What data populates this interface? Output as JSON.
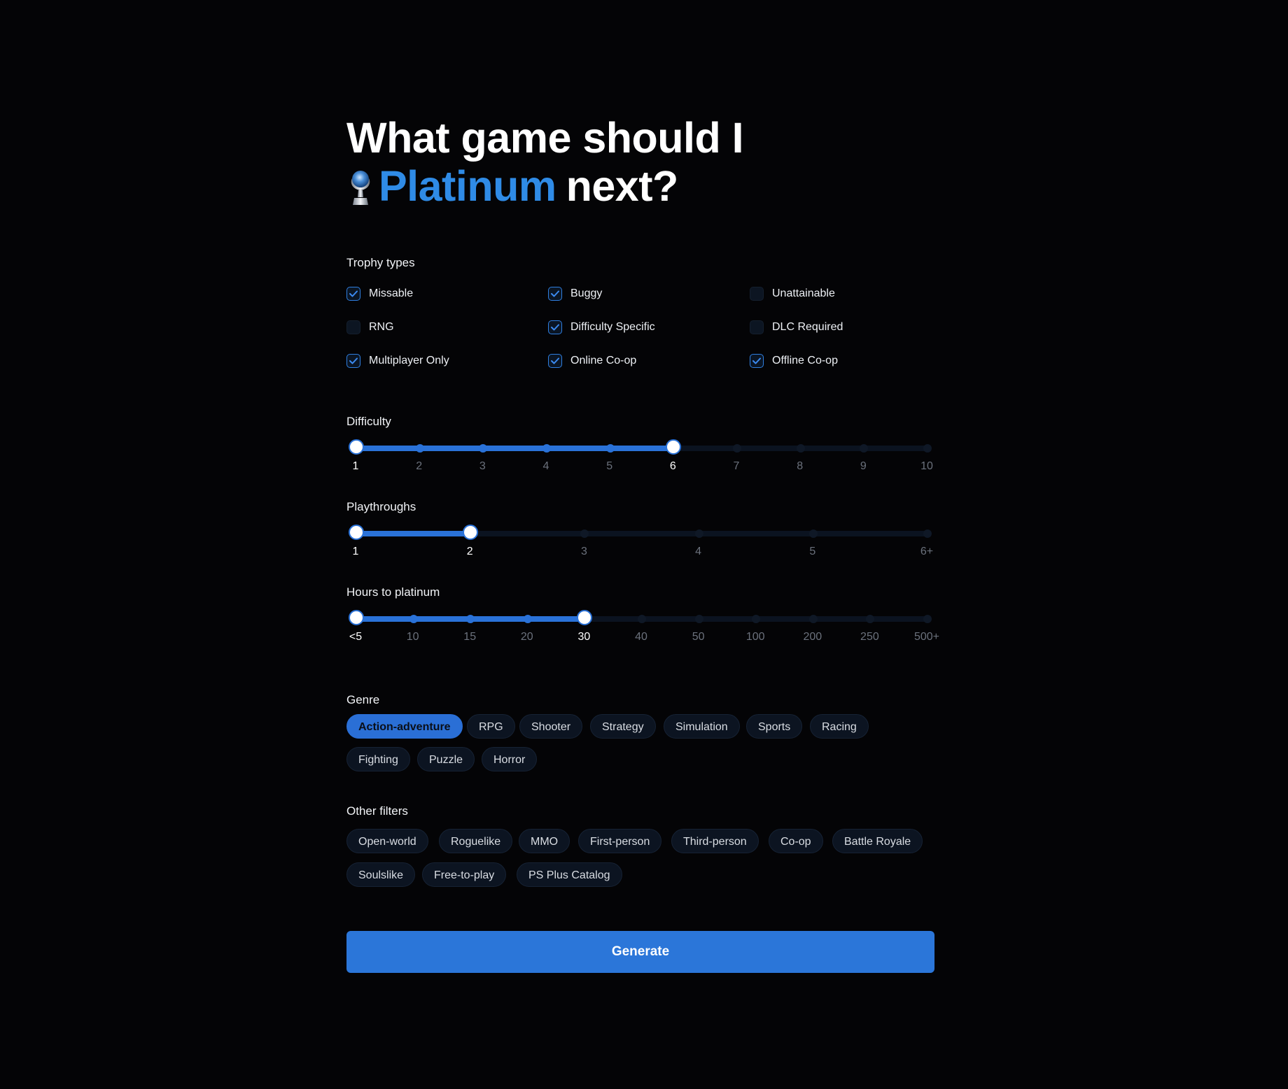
{
  "heading": {
    "line1": "What game should I",
    "accent": "Platinum",
    "rest": "next?",
    "icon": "platinum-trophy-icon",
    "accent_color": "#2f8be6"
  },
  "trophy_types": {
    "label": "Trophy types",
    "items": [
      {
        "label": "Missable",
        "checked": true
      },
      {
        "label": "Buggy",
        "checked": true
      },
      {
        "label": "Unattainable",
        "checked": false
      },
      {
        "label": "RNG",
        "checked": false
      },
      {
        "label": "Difficulty Specific",
        "checked": true
      },
      {
        "label": "DLC Required",
        "checked": false
      },
      {
        "label": "Multiplayer Only",
        "checked": true
      },
      {
        "label": "Online Co-op",
        "checked": true
      },
      {
        "label": "Offline Co-op",
        "checked": true
      }
    ]
  },
  "difficulty": {
    "label": "Difficulty",
    "ticks": [
      "1",
      "2",
      "3",
      "4",
      "5",
      "6",
      "7",
      "8",
      "9",
      "10"
    ],
    "min_index": 0,
    "max_index": 5
  },
  "playthroughs": {
    "label": "Playthroughs",
    "ticks": [
      "1",
      "2",
      "3",
      "4",
      "5",
      "6+"
    ],
    "min_index": 0,
    "max_index": 1
  },
  "hours": {
    "label": "Hours to platinum",
    "ticks": [
      "<5",
      "10",
      "15",
      "20",
      "30",
      "40",
      "50",
      "100",
      "200",
      "250",
      "500+"
    ],
    "min_index": 0,
    "max_index": 4
  },
  "genre": {
    "label": "Genre",
    "chips": [
      {
        "label": "Action-adventure",
        "selected": true
      },
      {
        "label": "RPG",
        "selected": false
      },
      {
        "label": "Shooter",
        "selected": false
      },
      {
        "label": "Strategy",
        "selected": false
      },
      {
        "label": "Simulation",
        "selected": false
      },
      {
        "label": "Sports",
        "selected": false
      },
      {
        "label": "Racing",
        "selected": false
      },
      {
        "label": "Fighting",
        "selected": false
      },
      {
        "label": "Puzzle",
        "selected": false
      },
      {
        "label": "Horror",
        "selected": false
      }
    ]
  },
  "other_filters": {
    "label": "Other filters",
    "chips": [
      {
        "label": "Open-world",
        "selected": false
      },
      {
        "label": "Roguelike",
        "selected": false
      },
      {
        "label": "MMO",
        "selected": false
      },
      {
        "label": "First-person",
        "selected": false
      },
      {
        "label": "Third-person",
        "selected": false
      },
      {
        "label": "Co-op",
        "selected": false
      },
      {
        "label": "Battle Royale",
        "selected": false
      },
      {
        "label": "Soulslike",
        "selected": false
      },
      {
        "label": "Free-to-play",
        "selected": false
      },
      {
        "label": "PS Plus Catalog",
        "selected": false
      }
    ]
  },
  "generate_label": "Generate"
}
